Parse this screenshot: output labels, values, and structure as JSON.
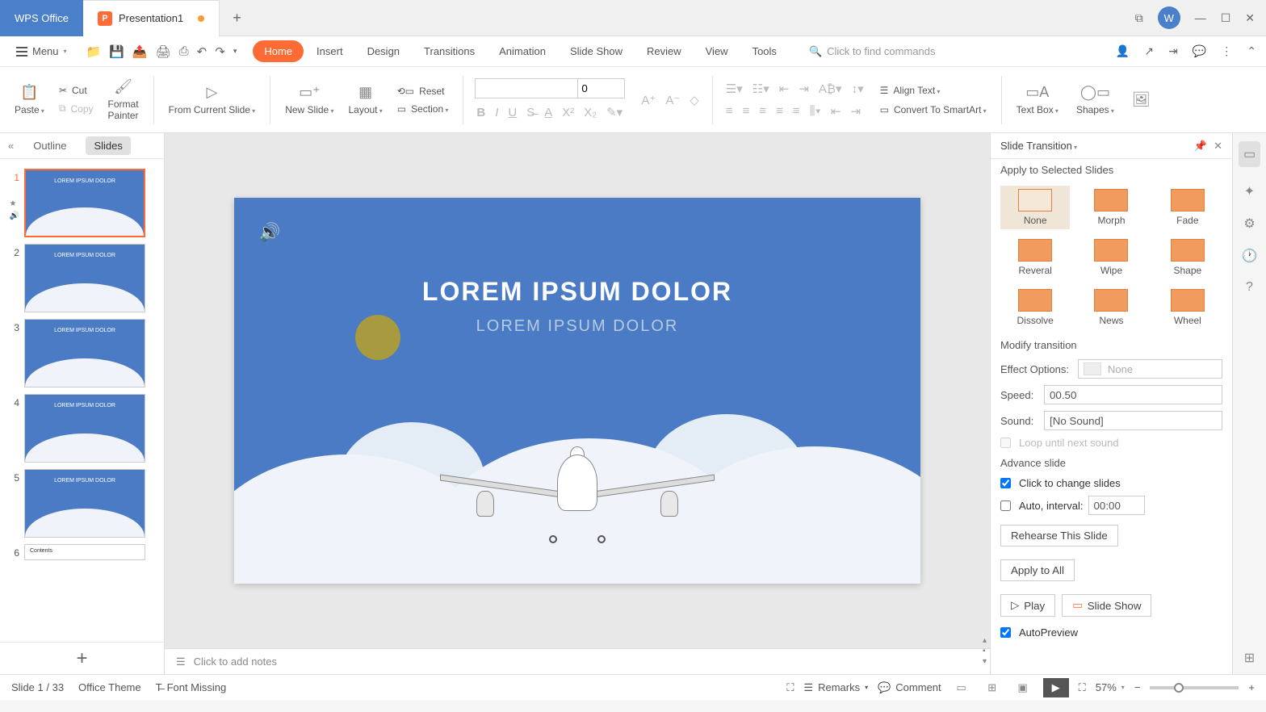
{
  "titlebar": {
    "app_name": "WPS Office",
    "doc_name": "Presentation1"
  },
  "menubar": {
    "menu_label": "Menu",
    "tabs": {
      "home": "Home",
      "insert": "Insert",
      "design": "Design",
      "transitions": "Transitions",
      "animation": "Animation",
      "slide_show": "Slide Show",
      "review": "Review",
      "view": "View",
      "tools": "Tools"
    },
    "search_placeholder": "Click to find commands"
  },
  "ribbon": {
    "paste": "Paste",
    "cut": "Cut",
    "copy": "Copy",
    "format_painter": "Format\nPainter",
    "from_current_slide": "From Current Slide",
    "new_slide": "New Slide",
    "layout": "Layout",
    "reset": "Reset",
    "section": "Section",
    "font_size": "0",
    "align_text": "Align Text",
    "convert_smartart": "Convert To SmartArt",
    "text_box": "Text Box",
    "shapes": "Shapes"
  },
  "slidepanel": {
    "outline": "Outline",
    "slides": "Slides",
    "thumbs": [
      {
        "n": "1",
        "title": "LOREM IPSUM DOLOR"
      },
      {
        "n": "2",
        "title": "LOREM IPSUM DOLOR"
      },
      {
        "n": "3",
        "title": "LOREM IPSUM DOLOR"
      },
      {
        "n": "4",
        "title": "LOREM IPSUM DOLOR"
      },
      {
        "n": "5",
        "title": "LOREM IPSUM DOLOR"
      },
      {
        "n": "6",
        "title": "Contents"
      }
    ]
  },
  "slide": {
    "title": "LOREM IPSUM DOLOR",
    "subtitle": "LOREM IPSUM DOLOR"
  },
  "notes": {
    "placeholder": "Click to add notes"
  },
  "taskpane": {
    "title": "Slide Transition",
    "apply_label": "Apply to Selected Slides",
    "transitions": {
      "none": "None",
      "morph": "Morph",
      "fade": "Fade",
      "reveral": "Reveral",
      "wipe": "Wipe",
      "shape": "Shape",
      "dissolve": "Dissolve",
      "news": "News",
      "wheel": "Wheel"
    },
    "modify_label": "Modify transition",
    "effect_options_label": "Effect Options:",
    "effect_options_value": "None",
    "speed_label": "Speed:",
    "speed_value": "00.50",
    "sound_label": "Sound:",
    "sound_value": "[No Sound]",
    "loop_label": "Loop until next sound",
    "advance_label": "Advance slide",
    "click_label": "Click to change slides",
    "auto_label": "Auto, interval:",
    "auto_value": "00:00",
    "rehearse": "Rehearse This Slide",
    "apply_all": "Apply to All",
    "play": "Play",
    "slide_show": "Slide Show",
    "autopreview": "AutoPreview"
  },
  "statusbar": {
    "slide_info": "Slide 1 / 33",
    "theme": "Office Theme",
    "font_missing": "Font Missing",
    "remarks": "Remarks",
    "comment": "Comment",
    "zoom": "57%"
  }
}
